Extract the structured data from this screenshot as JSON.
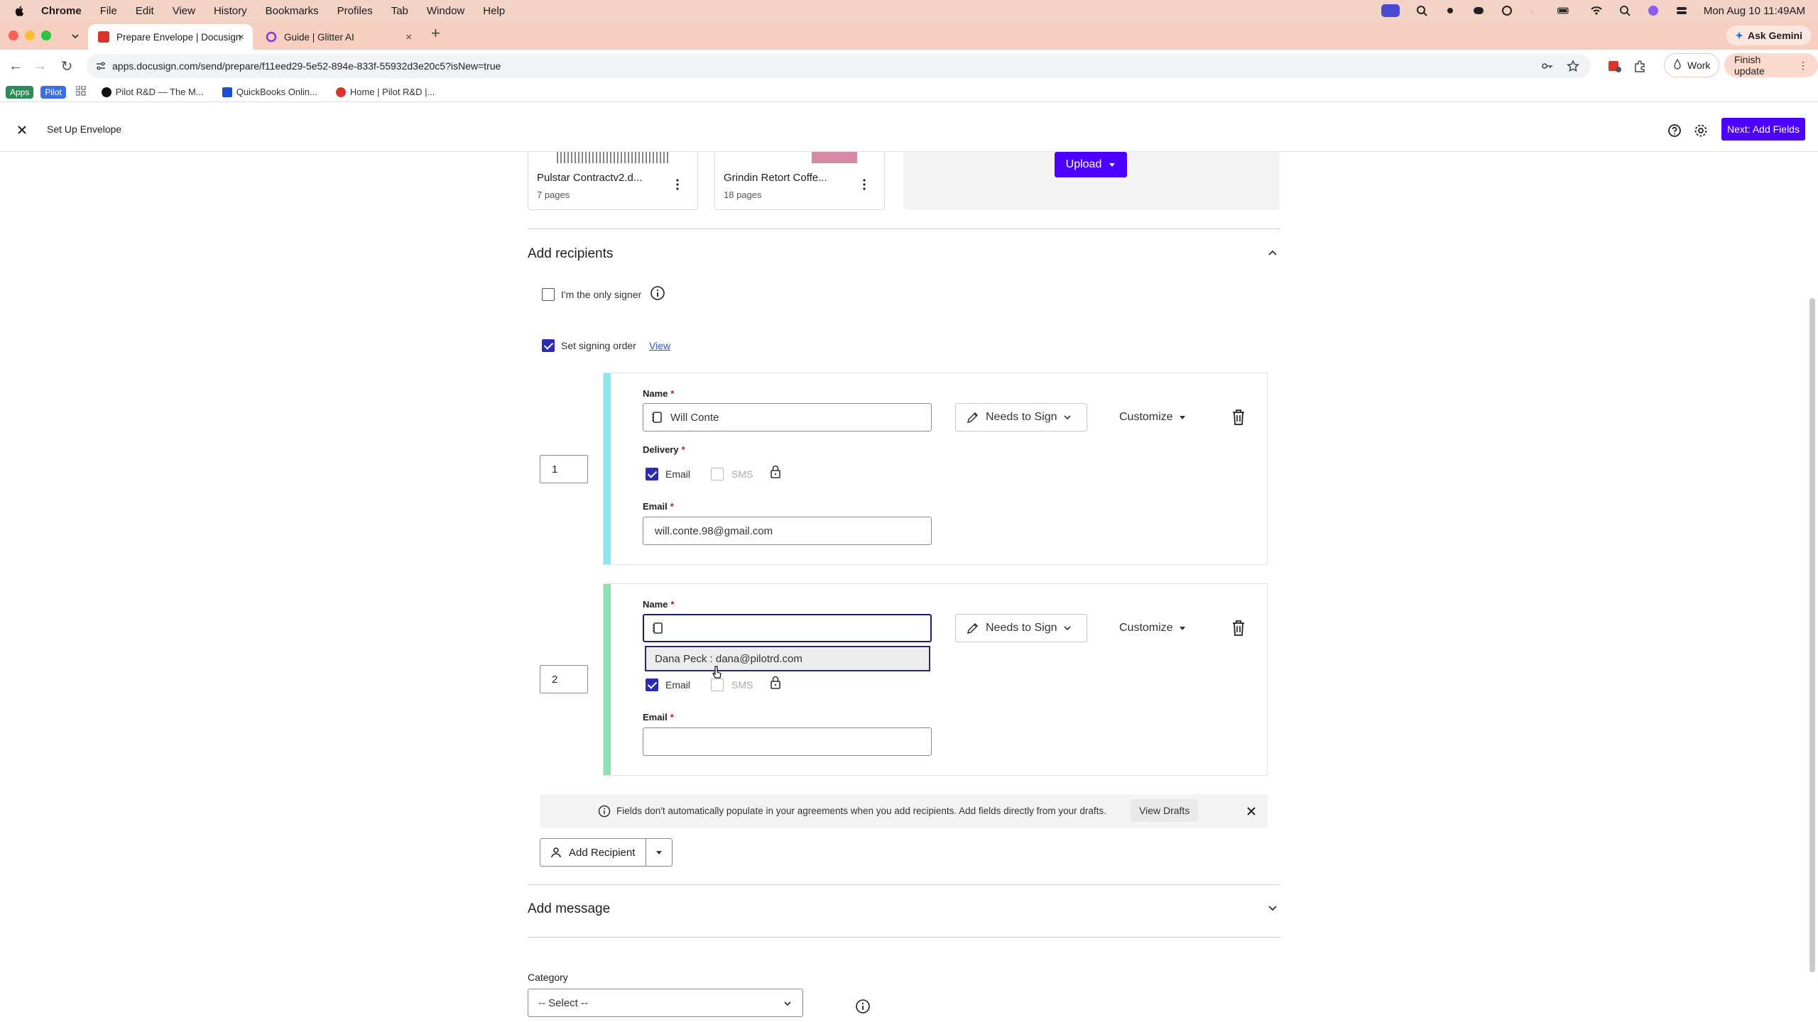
{
  "mac_menu": {
    "app": "Chrome",
    "items": [
      "File",
      "Edit",
      "View",
      "History",
      "Bookmarks",
      "Profiles",
      "Tab",
      "Window",
      "Help"
    ],
    "clock": "Mon Aug 10  11:49AM"
  },
  "chrome": {
    "tabs": [
      {
        "title": "Prepare Envelope | Docusign",
        "active": true
      },
      {
        "title": "Guide | Glitter AI",
        "active": false
      }
    ],
    "ask_gemini": "Ask Gemini",
    "url": "apps.docusign.com/send/prepare/f11eed29-5e52-894e-833f-55932d3e20c5?isNew=true",
    "profile": "Work",
    "finish_update": "Finish update",
    "bookmarks": {
      "apps_chip": "Apps",
      "pilot_chip": "Pilot",
      "items": [
        "Pilot R&D — The M...",
        "QuickBooks Onlin...",
        "Home | Pilot R&D |..."
      ]
    }
  },
  "header": {
    "title": "Set Up Envelope",
    "next_button": "Next: Add Fields"
  },
  "documents": [
    {
      "name": "Pulstar Contractv2.d...",
      "pages": "7 pages"
    },
    {
      "name": "Grindin Retort Coffe...",
      "pages": "18 pages"
    }
  ],
  "upload_button": "Upload",
  "recipients_section": {
    "title": "Add recipients",
    "only_signer_label": "I'm the only signer",
    "signing_order_label": "Set signing order",
    "view_link": "View",
    "recipients": [
      {
        "order": "1",
        "name_label": "Name",
        "name_value": "Will Conte",
        "action": "Needs to Sign",
        "customize": "Customize",
        "delivery_label": "Delivery",
        "email_option": "Email",
        "sms_option": "SMS",
        "email_label": "Email",
        "email_value": "will.conte.98@gmail.com",
        "color": "#8ee3f0"
      },
      {
        "order": "2",
        "name_label": "Name",
        "name_value": "",
        "action": "Needs to Sign",
        "customize": "Customize",
        "email_option": "Email",
        "sms_option": "SMS",
        "email_label": "Email",
        "email_value": "",
        "color": "#8ee0b4"
      }
    ],
    "suggestion": "Dana Peck : dana@pilotrd.com",
    "banner_text": "Fields don't automatically populate in your agreements when you add recipients. Add fields directly from your drafts.",
    "banner_button": "View Drafts",
    "add_recipient": "Add Recipient"
  },
  "message_section": {
    "title": "Add message"
  },
  "category": {
    "label": "Category",
    "selected": "-- Select --"
  },
  "colors": {
    "accent": "#4c00ff",
    "checkbox": "#2b2bb3",
    "required": "#c0152f"
  }
}
